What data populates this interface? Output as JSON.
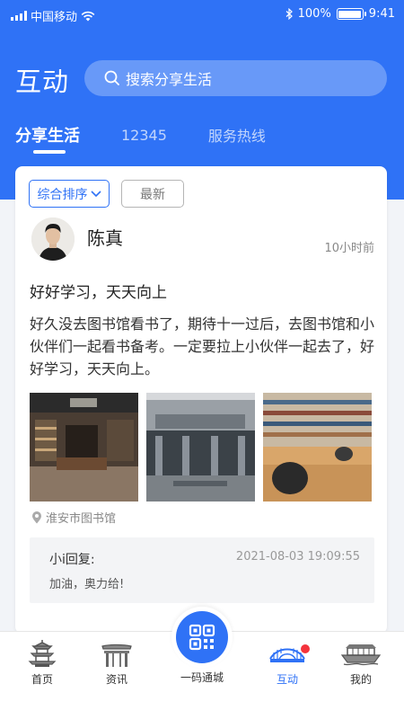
{
  "status_bar": {
    "carrier": "中国移动",
    "battery": "100%",
    "time": "9:41",
    "battery_level": 1.0
  },
  "header": {
    "title": "互动",
    "search_placeholder": "搜索分享生活"
  },
  "tabs": [
    {
      "label": "分享生活",
      "active": true
    },
    {
      "label": "12345",
      "active": false
    },
    {
      "label": "服务热线",
      "active": false
    }
  ],
  "filters": {
    "sort_label": "综合排序",
    "new_label": "最新"
  },
  "post": {
    "author": "陈真",
    "time": "10小时前",
    "title": "好好学习，天天向上",
    "body": "好久没去图书馆看书了，期待十一过后，去图书馆和小伙伴们一起看书备考。一定要拉上小伙伴一起去了，好好学习，天天向上。",
    "location": "淮安市图书馆",
    "reply": {
      "name": "小i回复:",
      "time": "2021-08-03  19:09:55",
      "text": "加油，奥力给!"
    }
  },
  "nav": {
    "items": [
      {
        "label": "首页",
        "icon": "pagoda-icon"
      },
      {
        "label": "资讯",
        "icon": "gate-icon"
      },
      {
        "label": "一码通城",
        "icon": "qr-code-icon"
      },
      {
        "label": "互动",
        "icon": "bridge-icon",
        "active": true
      },
      {
        "label": "我的",
        "icon": "boat-icon"
      }
    ]
  },
  "colors": {
    "primary": "#2f72f6",
    "badge": "#f4333c"
  }
}
